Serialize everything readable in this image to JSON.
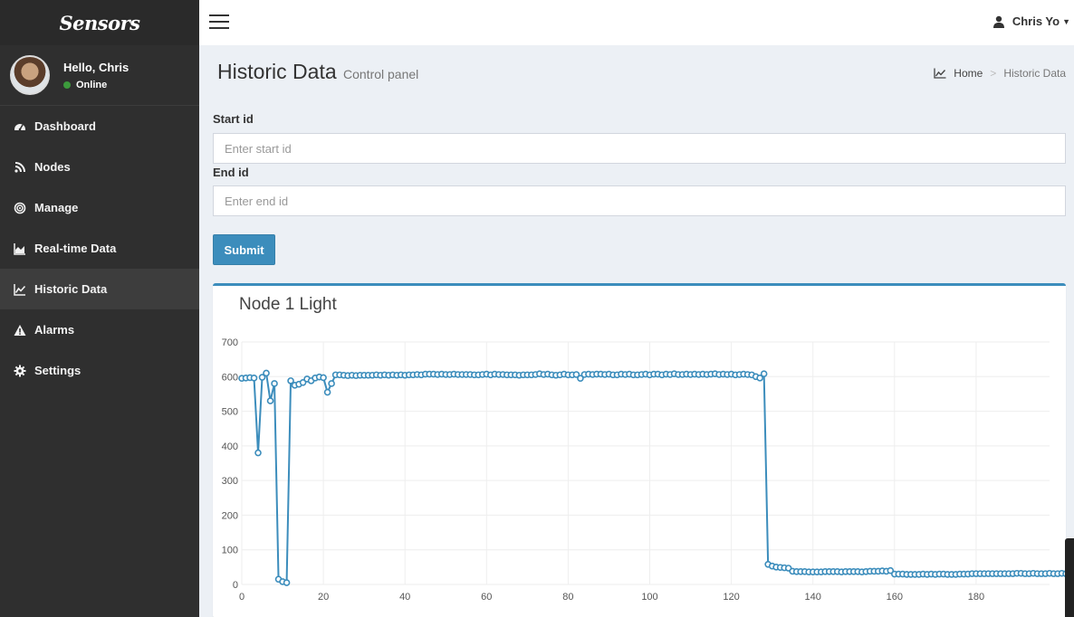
{
  "brand": "Sensors",
  "user": {
    "greeting": "Hello, Chris",
    "status": "Online",
    "name": "Chris Yo"
  },
  "sidebar": {
    "items": [
      {
        "label": "Dashboard",
        "icon": "dashboard-icon"
      },
      {
        "label": "Nodes",
        "icon": "rss-icon"
      },
      {
        "label": "Manage",
        "icon": "bullseye-icon"
      },
      {
        "label": "Real-time Data",
        "icon": "area-chart-icon"
      },
      {
        "label": "Historic Data",
        "icon": "line-chart-icon",
        "active": true
      },
      {
        "label": "Alarms",
        "icon": "warning-icon"
      },
      {
        "label": "Settings",
        "icon": "gear-icon"
      }
    ]
  },
  "page": {
    "title": "Historic Data",
    "subtitle": "Control panel"
  },
  "breadcrumb": {
    "home": "Home",
    "current": "Historic Data"
  },
  "form": {
    "start_label": "Start id",
    "start_placeholder": "Enter start id",
    "end_label": "End id",
    "end_placeholder": "Enter end id",
    "submit_label": "Submit"
  },
  "colors": {
    "accent": "#3c8dbc",
    "sidebar": "#2f2f2f",
    "online": "#3c9a3c"
  },
  "chart_data": {
    "type": "line",
    "title": "Node 1 Light",
    "xlabel": "",
    "ylabel": "",
    "xlim": [
      0,
      198
    ],
    "ylim": [
      0,
      700
    ],
    "x_ticks": [
      0,
      20,
      40,
      60,
      80,
      100,
      120,
      140,
      160,
      180
    ],
    "y_ticks": [
      0,
      100,
      200,
      300,
      400,
      500,
      600,
      700
    ],
    "grid": true,
    "legend": "none",
    "markers": "hollow-circle",
    "series": [
      {
        "name": "",
        "color": "#3c8dbc",
        "values": [
          595,
          596,
          597,
          596,
          380,
          598,
          610,
          530,
          580,
          15,
          8,
          5,
          588,
          575,
          578,
          583,
          593,
          588,
          596,
          599,
          597,
          555,
          580,
          605,
          605,
          604,
          603,
          604,
          603,
          604,
          604,
          604,
          604,
          605,
          604,
          605,
          604,
          605,
          604,
          605,
          604,
          605,
          605,
          606,
          605,
          607,
          607,
          607,
          606,
          607,
          606,
          606,
          607,
          606,
          606,
          606,
          606,
          605,
          605,
          606,
          607,
          605,
          607,
          606,
          606,
          605,
          605,
          605,
          604,
          605,
          605,
          605,
          606,
          608,
          606,
          607,
          605,
          604,
          605,
          607,
          605,
          605,
          606,
          595,
          606,
          607,
          606,
          607,
          607,
          606,
          607,
          605,
          605,
          607,
          606,
          607,
          605,
          605,
          606,
          607,
          605,
          607,
          607,
          605,
          607,
          606,
          608,
          606,
          606,
          607,
          606,
          607,
          606,
          607,
          606,
          607,
          608,
          606,
          607,
          606,
          607,
          605,
          606,
          607,
          606,
          605,
          600,
          596,
          608,
          58,
          53,
          50,
          49,
          48,
          47,
          38,
          37,
          37,
          37,
          36,
          36,
          36,
          36,
          37,
          37,
          37,
          37,
          36,
          37,
          37,
          37,
          37,
          36,
          37,
          38,
          38,
          38,
          39,
          38,
          40,
          30,
          30,
          30,
          29,
          29,
          29,
          29,
          30,
          29,
          30,
          29,
          30,
          30,
          29,
          29,
          29,
          30,
          30,
          30,
          31,
          31,
          31,
          31,
          31,
          31,
          31,
          31,
          31,
          31,
          31,
          32,
          32,
          31,
          31,
          32,
          31,
          31,
          31,
          32,
          31,
          31,
          32,
          31,
          31,
          31,
          31
        ]
      }
    ]
  }
}
